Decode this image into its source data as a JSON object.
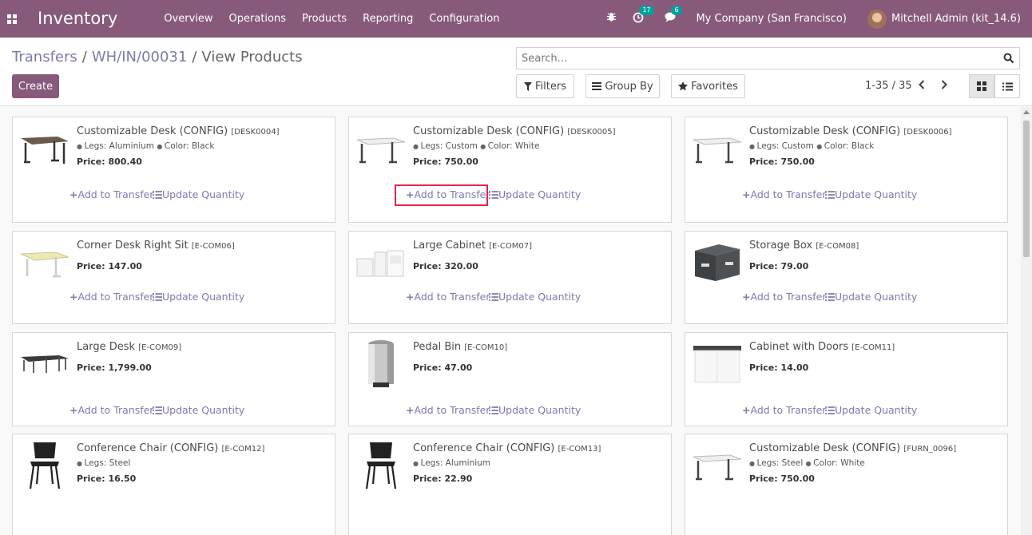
{
  "navbar": {
    "app_title": "Inventory",
    "menu": [
      "Overview",
      "Operations",
      "Products",
      "Reporting",
      "Configuration"
    ],
    "activity_count": "17",
    "messages_count": "6",
    "company": "My Company (San Francisco)",
    "user": "Mitchell Admin (kit_14.6)"
  },
  "breadcrumb": {
    "items": [
      "Transfers",
      "WH/IN/00031"
    ],
    "current": "View Products",
    "separator": "/"
  },
  "toolbar": {
    "create_label": "Create",
    "search_placeholder": "Search...",
    "filters_label": "Filters",
    "groupby_label": "Group By",
    "favorites_label": "Favorites",
    "pager": "1-35 / 35"
  },
  "actions": {
    "add_label": "Add to Transfer",
    "update_label": "Update Quantity"
  },
  "products": [
    {
      "name": "Customizable Desk (CONFIG)",
      "code": "[DESK0004]",
      "attrs": [
        "Legs: Aluminium",
        "Color: Black"
      ],
      "price": "Price: 800.40",
      "image": "desk-black-icon"
    },
    {
      "name": "Customizable Desk (CONFIG)",
      "code": "[DESK0005]",
      "attrs": [
        "Legs: Custom",
        "Color: White"
      ],
      "price": "Price: 750.00",
      "image": "desk-white-icon"
    },
    {
      "name": "Customizable Desk (CONFIG)",
      "code": "[DESK0006]",
      "attrs": [
        "Legs: Custom",
        "Color: Black"
      ],
      "price": "Price: 750.00",
      "image": "desk-white-icon"
    },
    {
      "name": "Corner Desk Right Sit",
      "code": "[E-COM06]",
      "attrs": [],
      "price": "Price: 147.00",
      "image": "corner-desk-icon"
    },
    {
      "name": "Large Cabinet",
      "code": "[E-COM07]",
      "attrs": [],
      "price": "Price: 320.00",
      "image": "cabinet-icon"
    },
    {
      "name": "Storage Box",
      "code": "[E-COM08]",
      "attrs": [],
      "price": "Price: 79.00",
      "image": "storage-box-icon"
    },
    {
      "name": "Large Desk",
      "code": "[E-COM09]",
      "attrs": [],
      "price": "Price: 1,799.00",
      "image": "large-desk-icon"
    },
    {
      "name": "Pedal Bin",
      "code": "[E-COM10]",
      "attrs": [],
      "price": "Price: 47.00",
      "image": "pedal-bin-icon"
    },
    {
      "name": "Cabinet with Doors",
      "code": "[E-COM11]",
      "attrs": [],
      "price": "Price: 14.00",
      "image": "cabinet-doors-icon"
    },
    {
      "name": "Conference Chair (CONFIG)",
      "code": "[E-COM12]",
      "attrs": [
        "Legs: Steel"
      ],
      "price": "Price: 16.50",
      "image": "chair-icon"
    },
    {
      "name": "Conference Chair (CONFIG)",
      "code": "[E-COM13]",
      "attrs": [
        "Legs: Aluminium"
      ],
      "price": "Price: 22.90",
      "image": "chair-icon"
    },
    {
      "name": "Customizable Desk (CONFIG)",
      "code": "[FURN_0096]",
      "attrs": [
        "Legs: Steel",
        "Color: White"
      ],
      "price": "Price: 750.00",
      "image": "desk-white-icon"
    }
  ],
  "highlighted_cards": [
    0,
    2,
    4
  ],
  "colors": {
    "brand": "#875a7b",
    "link": "#7c7bad",
    "highlight": "#e4244c",
    "badge": "#00a09d"
  }
}
